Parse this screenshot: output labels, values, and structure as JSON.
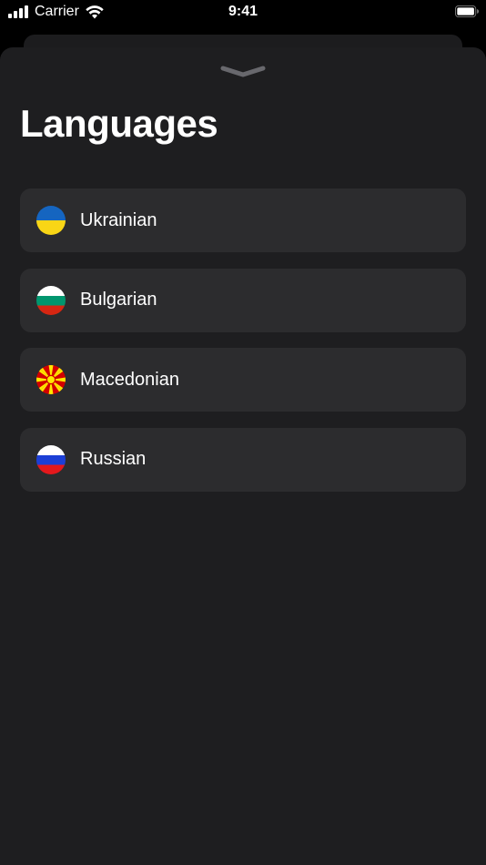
{
  "status_bar": {
    "carrier": "Carrier",
    "time": "9:41",
    "icons": [
      "signal-icon",
      "wifi-icon",
      "battery-icon"
    ]
  },
  "sheet": {
    "grabber_icon": "chevron-down-icon",
    "title": "Languages"
  },
  "languages": [
    {
      "label": "Ukrainian",
      "flag_icon": "ukraine-flag-icon",
      "colors": [
        "#1565c0",
        "#f9d616"
      ]
    },
    {
      "label": "Bulgarian",
      "flag_icon": "bulgaria-flag-icon",
      "colors": [
        "#ffffff",
        "#00966e",
        "#d62612"
      ]
    },
    {
      "label": "Macedonian",
      "flag_icon": "macedonia-flag-icon",
      "colors": [
        "#d20000",
        "#ffe600"
      ]
    },
    {
      "label": "Russian",
      "flag_icon": "russia-flag-icon",
      "colors": [
        "#ffffff",
        "#1c3fd6",
        "#e4181c"
      ]
    }
  ],
  "colors": {
    "background": "#000000",
    "sheet": "#1e1e20",
    "row": "#2c2c2e",
    "text": "#ffffff",
    "grabber": "#68686d"
  }
}
